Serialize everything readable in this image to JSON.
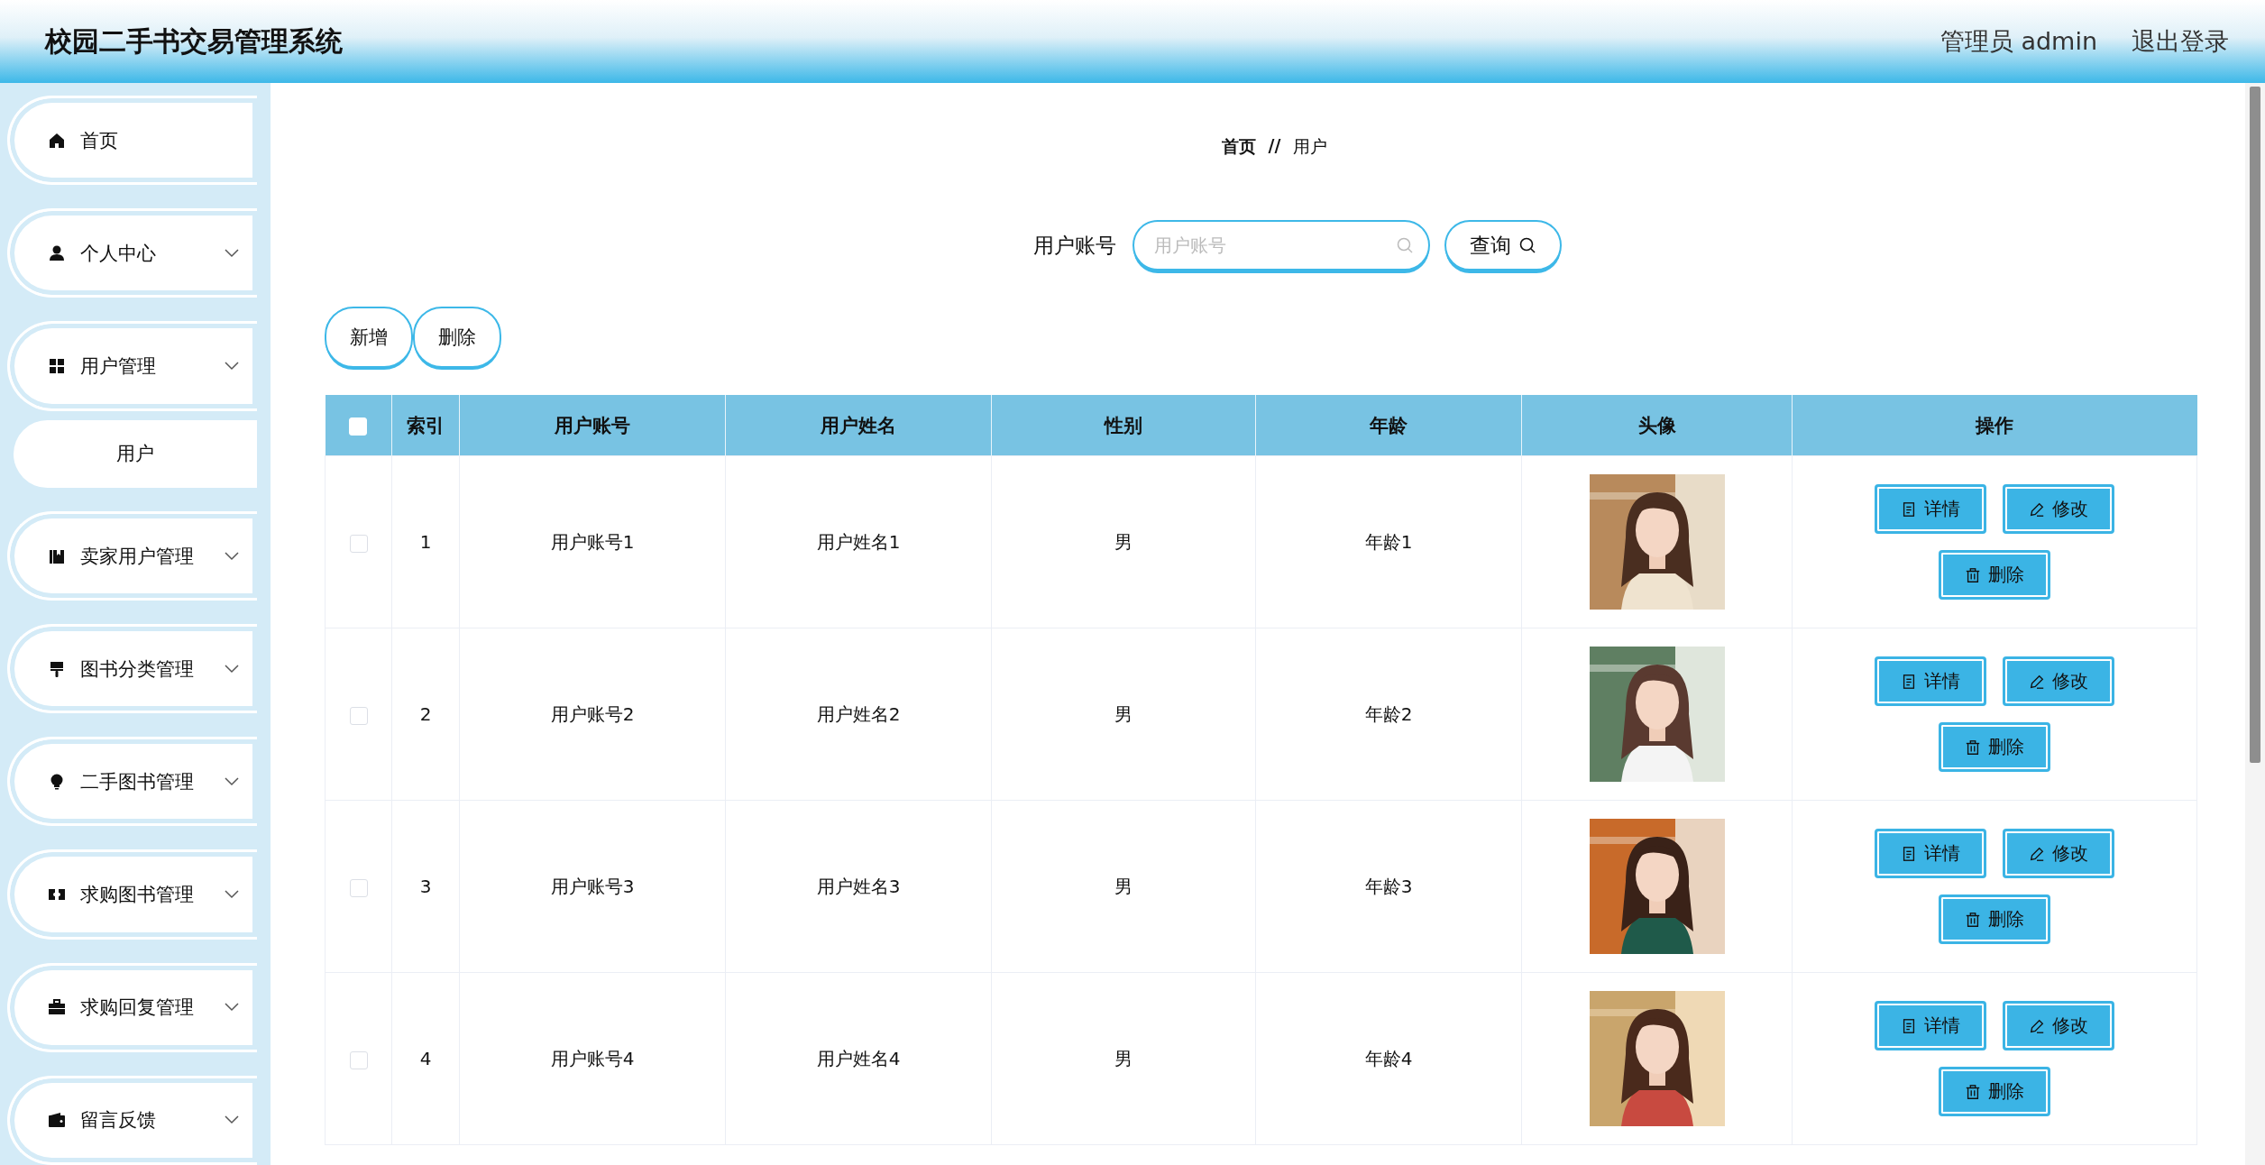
{
  "header": {
    "title": "校园二手书交易管理系统",
    "user": "管理员 admin",
    "logout": "退出登录"
  },
  "sidebar": {
    "items": [
      {
        "kind": "link",
        "label": "首页"
      },
      {
        "kind": "menu",
        "label": "个人中心"
      },
      {
        "kind": "menu",
        "label": "用户管理",
        "children": [
          {
            "label": "用户"
          }
        ]
      },
      {
        "kind": "menu",
        "label": "卖家用户管理"
      },
      {
        "kind": "menu",
        "label": "图书分类管理"
      },
      {
        "kind": "menu",
        "label": "二手图书管理"
      },
      {
        "kind": "menu",
        "label": "求购图书管理"
      },
      {
        "kind": "menu",
        "label": "求购回复管理"
      },
      {
        "kind": "menu",
        "label": "留言反馈"
      }
    ]
  },
  "breadcrumb": {
    "items": [
      "首页",
      "用户"
    ],
    "separator": "//"
  },
  "search": {
    "label": "用户账号",
    "placeholder": "用户账号",
    "button": "查询"
  },
  "toolbar": [
    "新增",
    "删除"
  ],
  "table": {
    "select_all_checked": false,
    "columns": [
      "索引",
      "用户账号",
      "用户姓名",
      "性别",
      "年龄",
      "头像",
      "操作"
    ],
    "rows": [
      {
        "checked": false,
        "cells": [
          "1",
          "用户账号1",
          "用户姓名1",
          "男",
          "年龄1"
        ],
        "avatar": {
          "kind": "picture"
        },
        "actions": [
          "详情",
          "修改",
          "删除"
        ]
      },
      {
        "checked": false,
        "cells": [
          "2",
          "用户账号2",
          "用户姓名2",
          "男",
          "年龄2"
        ],
        "avatar": {
          "kind": "picture"
        },
        "actions": [
          "详情",
          "修改",
          "删除"
        ]
      },
      {
        "checked": false,
        "cells": [
          "3",
          "用户账号3",
          "用户姓名3",
          "男",
          "年龄3"
        ],
        "avatar": {
          "kind": "picture"
        },
        "actions": [
          "详情",
          "修改",
          "删除"
        ]
      },
      {
        "checked": false,
        "cells": [
          "4",
          "用户账号4",
          "用户姓名4",
          "男",
          "年龄4"
        ],
        "avatar": {
          "kind": "picture"
        },
        "actions": [
          "详情",
          "修改",
          "删除"
        ]
      }
    ]
  }
}
